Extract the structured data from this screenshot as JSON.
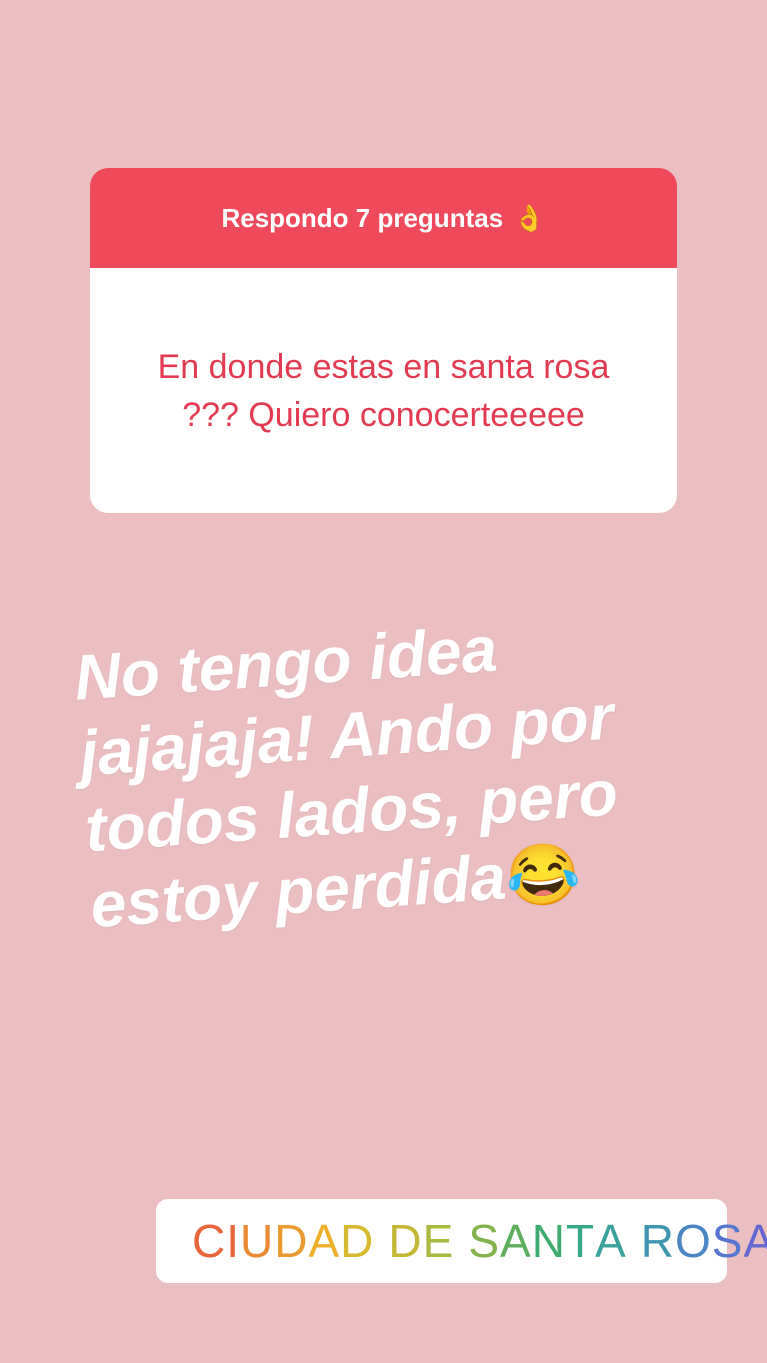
{
  "question_sticker": {
    "header": "Respondo 7 preguntas",
    "header_emoji": "👌",
    "question": "En donde estas en santa rosa ??? Quiero conocerteeeee"
  },
  "answer": {
    "text": "No tengo idea jajajaja! Ando por todos lados, pero estoy perdida",
    "emoji": "😂"
  },
  "location_sticker": {
    "icon": "location-pin-icon",
    "label": "CIUDAD DE SANTA ROSA",
    "letter_colors": [
      "#e8663a",
      "#e8663a",
      "#e98a35",
      "#eb9a2f",
      "#eeb02a",
      "#d6b930",
      "#c5b635",
      "#a9b83e",
      "#82b34c",
      "#5cae5a",
      "#3eac6e",
      "#35a887",
      "#3aa19c",
      "#3f96b0",
      "#4a86c3",
      "#5677cf",
      "#6469d2",
      "#735fd0",
      "#8456cc",
      "#9450c7"
    ]
  },
  "colors": {
    "background": "#ebbfc1",
    "header": "#ee4a5c",
    "question_text": "#e23b51",
    "pin": "#e8663a"
  }
}
